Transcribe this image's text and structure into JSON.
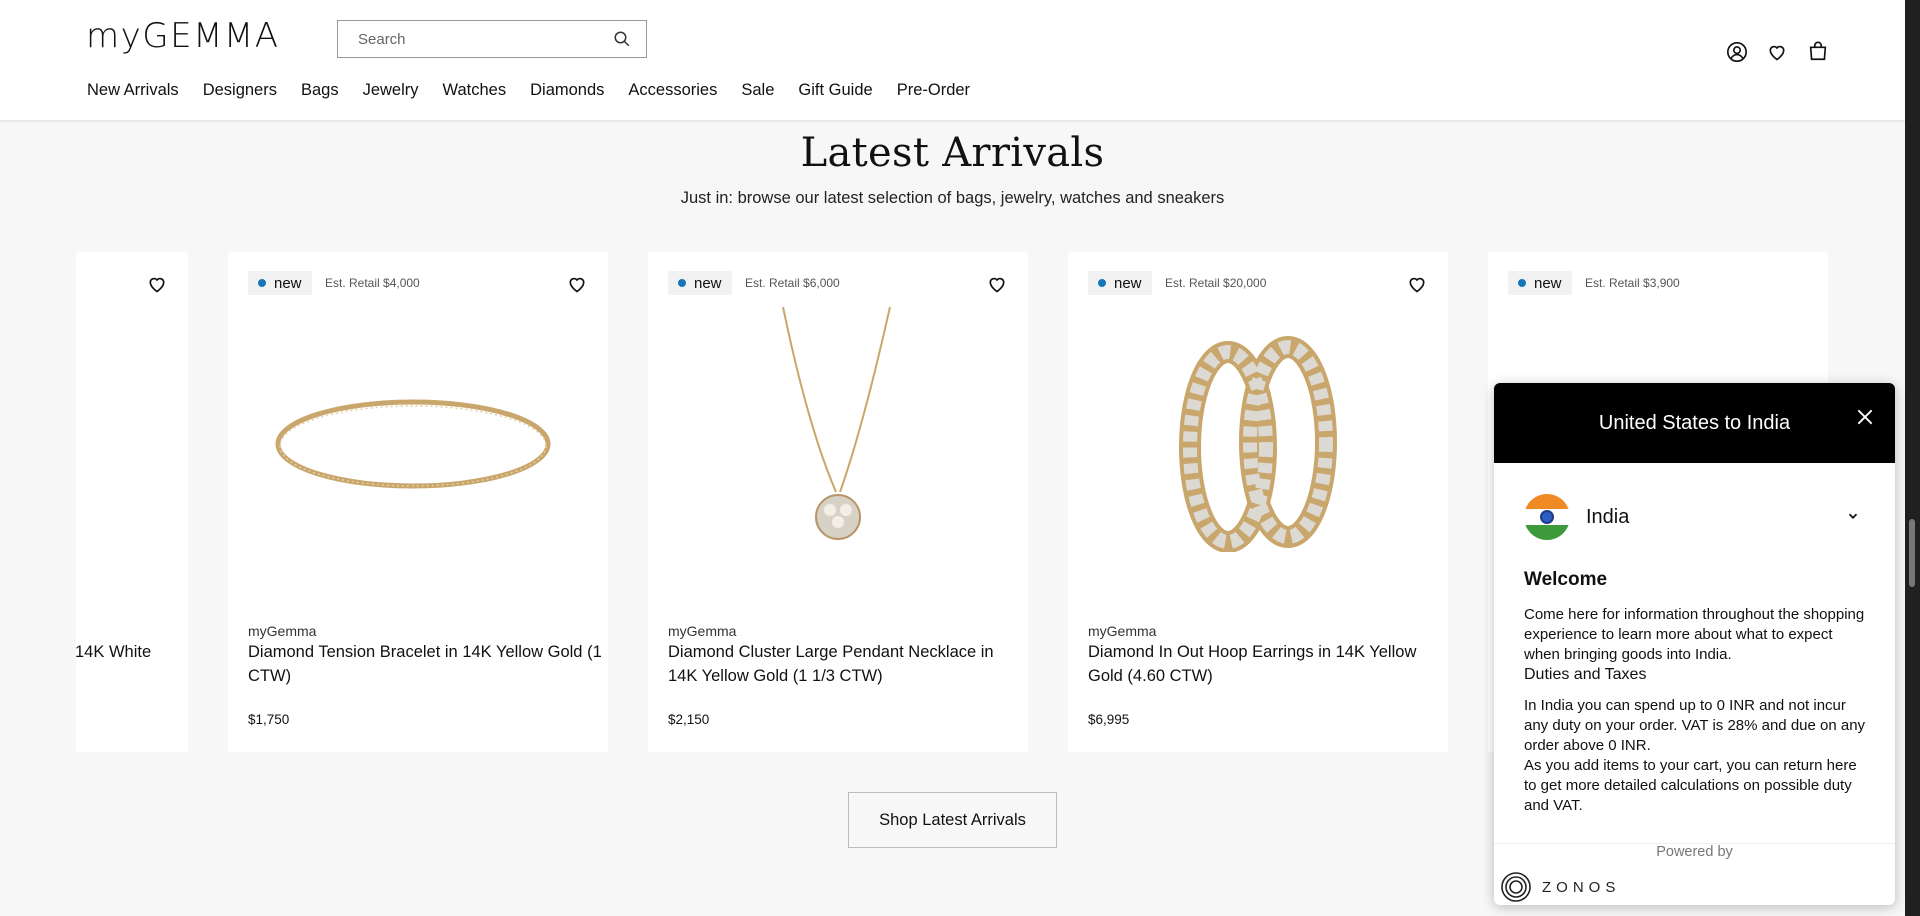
{
  "header": {
    "logo": "myGEMMA",
    "search_placeholder": "Search",
    "nav": [
      "New Arrivals",
      "Designers",
      "Bags",
      "Jewelry",
      "Watches",
      "Diamonds",
      "Accessories",
      "Sale",
      "Gift Guide",
      "Pre-Order"
    ]
  },
  "section": {
    "title": "Latest Arrivals",
    "subtitle": "Just in: browse our latest selection of bags, jewelry, watches and sneakers",
    "button": "Shop Latest Arrivals"
  },
  "products": [
    {
      "name_fragment": "14K White"
    },
    {
      "badge": "new",
      "retail": "Est. Retail $4,000",
      "brand": "myGemma",
      "name": "Diamond Tension Bracelet in 14K Yellow Gold (1 CTW)",
      "price": "$1,750"
    },
    {
      "badge": "new",
      "retail": "Est. Retail $6,000",
      "brand": "myGemma",
      "name": "Diamond Cluster Large Pendant Necklace in 14K Yellow Gold (1 1/3 CTW)",
      "price": "$2,150"
    },
    {
      "badge": "new",
      "retail": "Est. Retail $20,000",
      "brand": "myGemma",
      "name": "Diamond In Out Hoop Earrings in 14K Yellow Gold (4.60 CTW)",
      "price": "$6,995"
    },
    {
      "badge": "new",
      "retail": "Est. Retail $3,900"
    }
  ],
  "modal": {
    "title": "United States to India",
    "country": "India",
    "welcome": "Welcome",
    "p1": "Come here for information throughout the shopping experience to learn more about what to expect when bringing goods into India.",
    "duties_heading": "Duties and Taxes",
    "p2": "In India you can spend up to 0 INR and not incur any duty on your order. VAT is 28% and due on any order above 0 INR.",
    "p3": "As you add items to your cart, you can return here to get more detailed calculations on possible duty and VAT.",
    "powered_by": "Powered by",
    "brand": "ZONOS"
  },
  "colors": {
    "accent_dot": "#1577b8",
    "modal_header": "#000000"
  }
}
